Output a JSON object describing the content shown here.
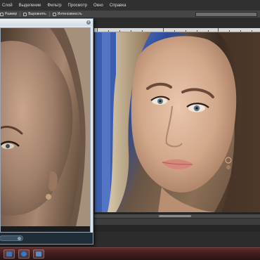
{
  "menu": {
    "items": [
      "Слой",
      "Выделение",
      "Фильтр",
      "Просмотр",
      "Окно",
      "Справка"
    ]
  },
  "toolbar": {
    "items": [
      {
        "label": "Размер",
        "icon": "resize-icon"
      },
      {
        "label": "Выровнять",
        "icon": "align-icon"
      },
      {
        "label": "Интенсивность",
        "icon": "intensity-icon"
      }
    ]
  },
  "taskbar": {
    "buttons": [
      {
        "icon": "photoshop-app-icon",
        "color": "#4a6fb0"
      },
      {
        "icon": "browser-app-icon",
        "color": "#2e7bd6"
      },
      {
        "icon": "image-viewer-app-icon",
        "color": "#5b8cc4"
      }
    ]
  },
  "colors": {
    "menubar": "#303030",
    "toolbar": "#454545",
    "workspace": "#2c2c2c",
    "dialog": "#dfe5ea",
    "taskbar": "#3c1a1a"
  }
}
